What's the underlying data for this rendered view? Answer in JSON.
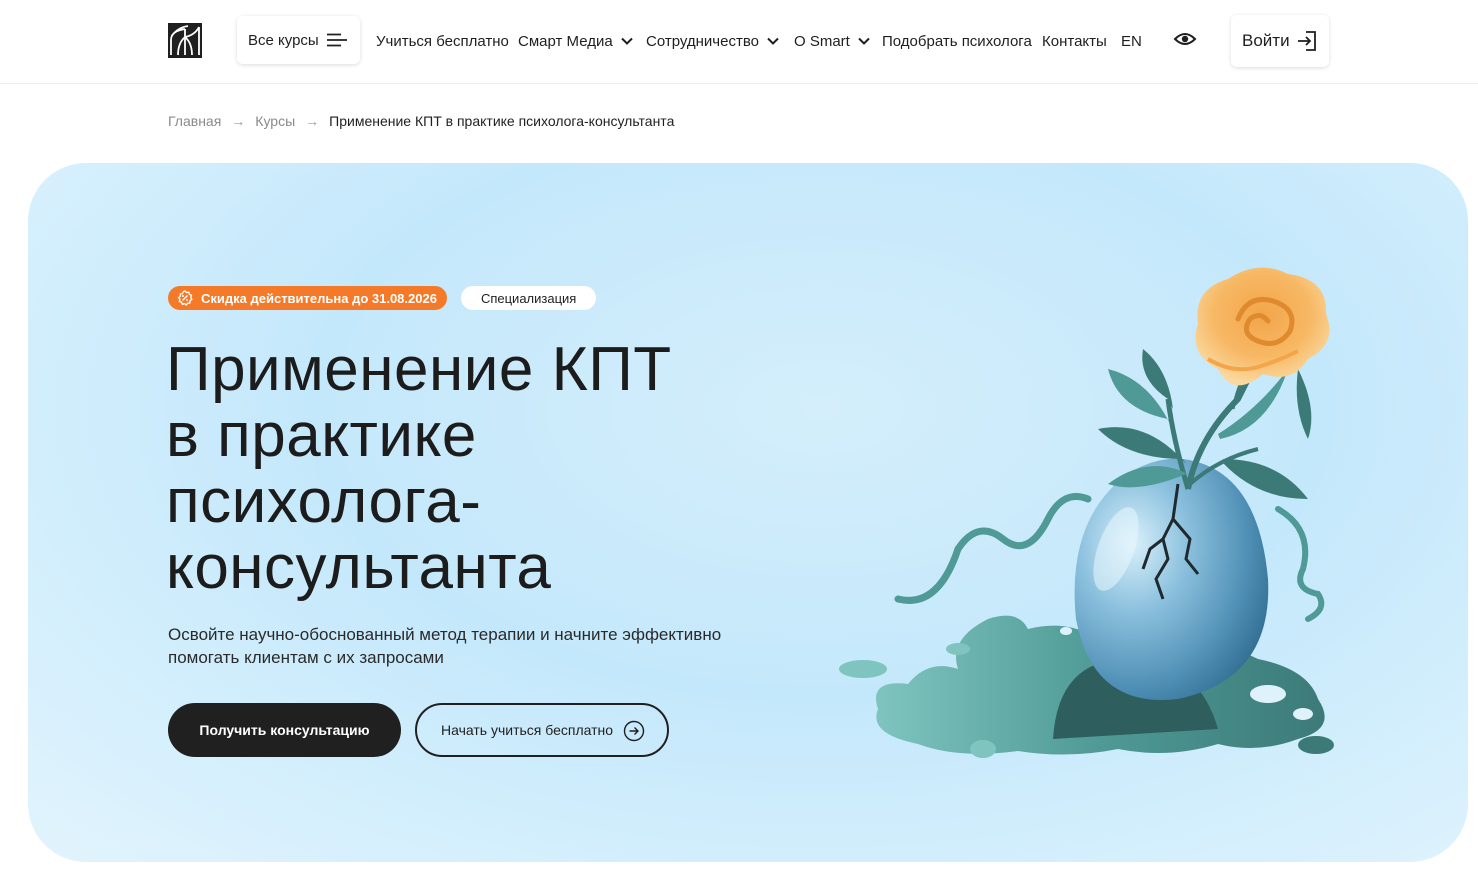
{
  "header": {
    "logo_icon": "smart-logo-icon",
    "all_courses_label": "Все курсы",
    "nav": [
      {
        "label": "Учиться бесплатно",
        "has_dropdown": false
      },
      {
        "label": "Смарт Медиа",
        "has_dropdown": true
      },
      {
        "label": "Сотрудничество",
        "has_dropdown": true
      },
      {
        "label": "O Smart",
        "has_dropdown": true
      },
      {
        "label": "Подобрать психолога",
        "has_dropdown": false
      },
      {
        "label": "Контакты",
        "has_dropdown": false
      },
      {
        "label": "EN",
        "has_dropdown": false
      }
    ],
    "accessibility_icon": "eye-icon",
    "login_label": "Войти"
  },
  "breadcrumb": {
    "items": [
      "Главная",
      "Курсы"
    ],
    "separator": "→",
    "current": "Применение КПТ в практике психолога-консультанта"
  },
  "hero": {
    "discount_badge": "Скидка действительна до 31.08.2026",
    "type_badge": "Специализация",
    "title_lines": [
      "Применение КПТ",
      "в практике",
      "психолога-",
      "консультанта"
    ],
    "subtitle": "Освойте научно-обоснованный метод терапии и начните эффективно помогать клиентам с их запросами",
    "primary_button": "Получить консультацию",
    "secondary_button": "Начать учиться бесплатно"
  },
  "colors": {
    "accent_orange": "#f47a2a",
    "dark": "#202020",
    "hero_background": "#c4e8fb"
  }
}
